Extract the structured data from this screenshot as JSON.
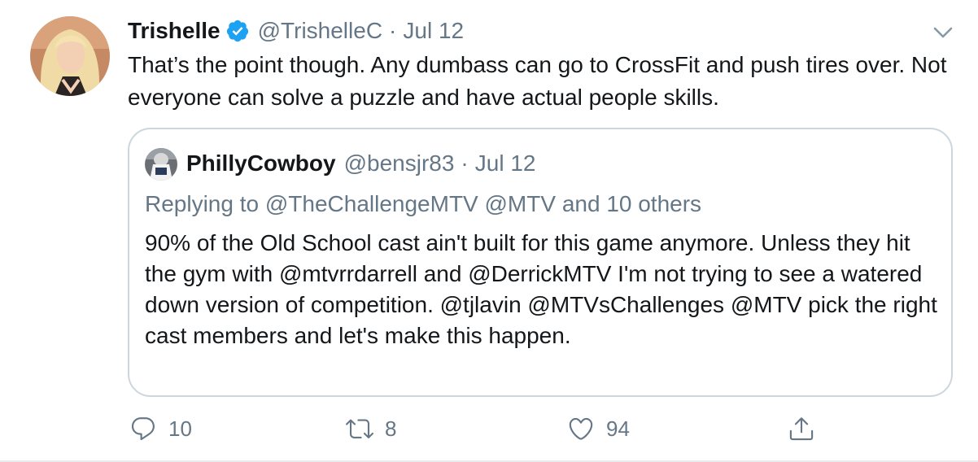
{
  "tweet": {
    "display_name": "Trishelle",
    "handle": "@TrishelleC",
    "separator": "·",
    "date": "Jul 12",
    "text": "That’s the point though. Any dumbass can go to CrossFit and push tires over. Not everyone can solve a puzzle and have actual people skills."
  },
  "quoted_tweet": {
    "display_name": "PhillyCowboy",
    "handle": "@bensjr83",
    "separator": "·",
    "date": "Jul 12",
    "replying_to": "Replying to @TheChallengeMTV @MTV and 10 others",
    "text": "90% of the Old School cast ain't built for this game anymore. Unless they hit the gym with @mtvrrdarrell and @DerrickMTV I'm not trying to see a watered down version of competition. @tjlavin @MTVsChallenges @MTV pick the right cast members and let's make this happen."
  },
  "actions": {
    "reply_count": "10",
    "retweet_count": "8",
    "like_count": "94"
  },
  "icons": {
    "verified": "verified-badge-icon",
    "caret": "chevron-down-icon",
    "reply": "reply-icon",
    "retweet": "retweet-icon",
    "like": "heart-icon",
    "share": "share-icon"
  },
  "colors": {
    "text_primary": "#14171a",
    "text_secondary": "#657786",
    "verified_blue": "#1da1f2",
    "border": "#ccd6dd"
  }
}
